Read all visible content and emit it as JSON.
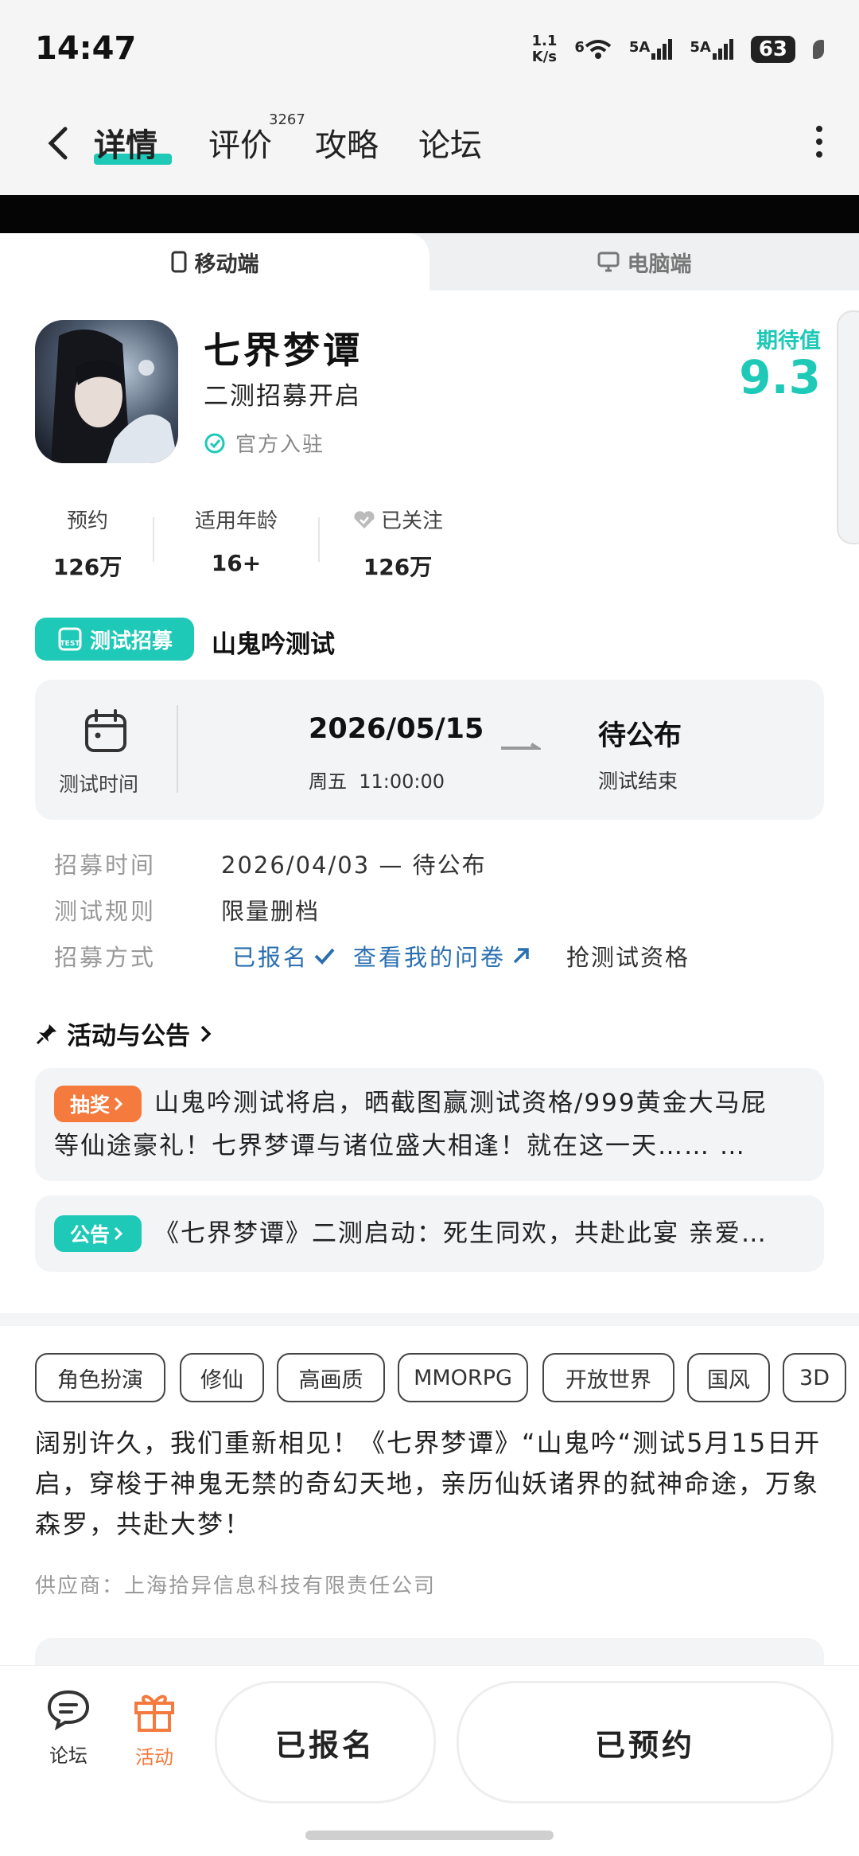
{
  "status": {
    "time": "14:47",
    "net_speed_top": "1.1",
    "net_speed_unit": "K/s",
    "wifi_sub": "6",
    "sig1": "5A",
    "sig2": "5A",
    "battery": "63"
  },
  "nav": {
    "tabs": [
      "详情",
      "评价",
      "攻略",
      "论坛"
    ],
    "review_count": "3267"
  },
  "platform": {
    "mobile": "移动端",
    "pc": "电脑端"
  },
  "game": {
    "title": "七界梦谭",
    "subtitle": "二测招募开启",
    "official": "官方入驻",
    "expect_label": "期待值",
    "expect_score": "9.3"
  },
  "stats": [
    {
      "label": "预约",
      "value": "126万"
    },
    {
      "label": "适用年龄",
      "value": "16+"
    },
    {
      "label": "已关注",
      "value": "126万"
    }
  ],
  "recruit": {
    "badge": "测试招募",
    "title": "山鬼吟测试",
    "test_time_label": "测试时间",
    "start_date": "2026/05/15",
    "start_time": "周五  11:00:00",
    "end": "待公布",
    "end_label": "测试结束",
    "rows": [
      {
        "label": "招募时间",
        "value": "2026/04/03 — 待公布"
      },
      {
        "label": "测试规则",
        "value": "限量删档"
      },
      {
        "label": "招募方式",
        "registered": "已报名",
        "survey": "查看我的问卷",
        "qualify": "抢测试资格"
      }
    ]
  },
  "activity": {
    "header": "活动与公告",
    "items": [
      {
        "tag": "抽奖",
        "color": "#f47a3d",
        "line1": "山鬼吟测试将启，晒截图赢测试资格/999黄金大马屁",
        "line2": "等仙途豪礼！七界梦谭与诸位盛大相逢！就在这一天……  …"
      },
      {
        "tag": "公告",
        "color": "#1ec9b7",
        "line1": "《七界梦谭》二测启动：死生同欢，共赴此宴 亲爱…"
      }
    ]
  },
  "tags": [
    "角色扮演",
    "修仙",
    "高画质",
    "MMORPG",
    "开放世界",
    "国风",
    "3D"
  ],
  "description": "阔别许久，我们重新相见！《七界梦谭》“山鬼吟“测试5月15日开启，穿梭于神鬼无禁的奇幻天地，亲历仙妖诸界的弑神命途，万象森罗，共赴大梦！",
  "supplier": "供应商：上海拾异信息科技有限责任公司",
  "bottom": {
    "forum": "论坛",
    "activity": "活动",
    "btn_registered": "已报名",
    "btn_reserved": "已预约"
  },
  "colors": {
    "accent": "#1ec9b7",
    "orange": "#f47a3d",
    "link": "#2a6fb0"
  }
}
